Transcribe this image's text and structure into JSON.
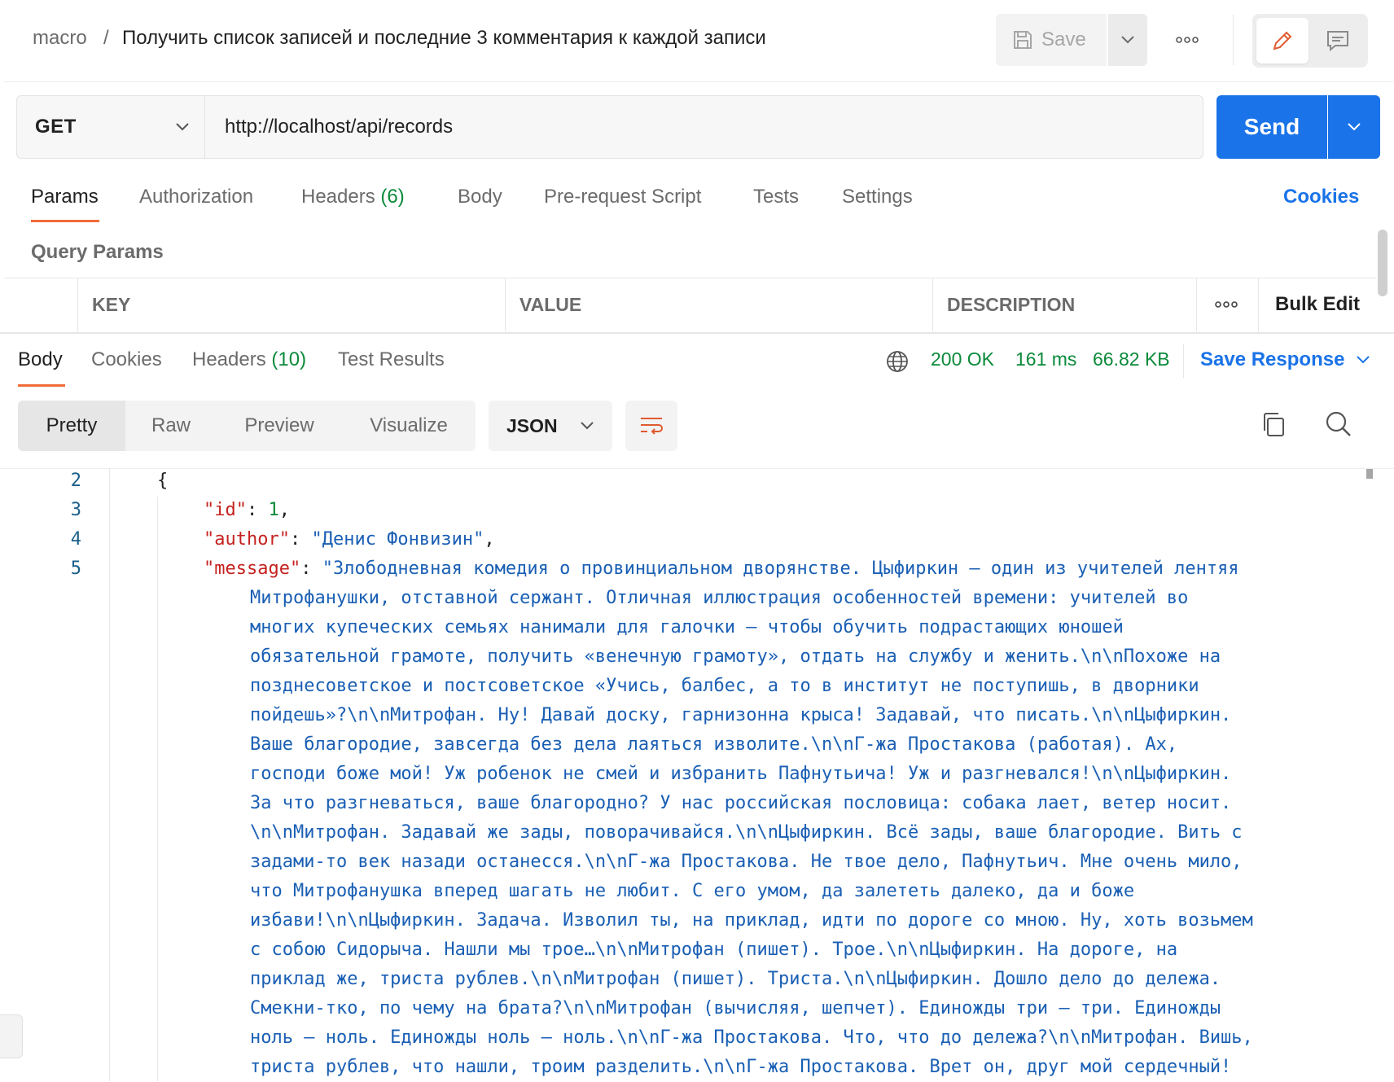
{
  "header": {
    "workspace": "macro",
    "separator": "/",
    "request_name": "Получить список записей и последние 3 комментария к каждой записи",
    "save_label": "Save"
  },
  "request": {
    "method": "GET",
    "url": "http://localhost/api/records",
    "send_label": "Send"
  },
  "request_tabs": {
    "params": "Params",
    "authorization": "Authorization",
    "headers": "Headers",
    "headers_count": "(6)",
    "body": "Body",
    "prerequest": "Pre-request Script",
    "tests": "Tests",
    "settings": "Settings",
    "cookies": "Cookies"
  },
  "query_params": {
    "title": "Query Params",
    "columns": [
      "KEY",
      "VALUE",
      "DESCRIPTION"
    ],
    "bulk_edit": "Bulk Edit"
  },
  "response_tabs": {
    "body": "Body",
    "cookies": "Cookies",
    "headers": "Headers",
    "headers_count": "(10)",
    "test_results": "Test Results"
  },
  "response_status": {
    "status": "200 OK",
    "time": "161 ms",
    "size": "66.82 KB",
    "save_response": "Save Response"
  },
  "format": {
    "pretty": "Pretty",
    "raw": "Raw",
    "preview": "Preview",
    "visualize": "Visualize",
    "language": "JSON"
  },
  "code": {
    "line_numbers": [
      "2",
      "3",
      "4",
      "5"
    ],
    "open_brace": "{",
    "id_key": "\"id\"",
    "id_value": "1",
    "author_key": "\"author\"",
    "author_value": "\"Денис Фонвизин\"",
    "message_key": "\"message\"",
    "message_lines": [
      "\"Злободневная комедия о провинциальном дворянстве. Цыфиркин — один из учителей лентяя",
      "Митрофанушки, отставной сержант. Отличная иллюстрация особенностей времени: учителей во",
      "многих купеческих семьях нанимали для галочки — чтобы обучить подрастающих юношей",
      "обязательной грамоте, получить «венечную грамоту», отдать на службу и женить.\\n\\nПохоже на",
      "позднесоветское и постсоветское «Учись, балбес, а то в институт не поступишь, в дворники",
      "пойдешь»?\\n\\nМитрофан. Ну! Давай доску, гарнизонна крыса! Задавай, что писать.\\n\\nЦыфиркин.",
      "Ваше благородие, завсегда без дела лаяться изволите.\\n\\nГ-жа Простакова (работая). Ах,",
      "господи боже мой! Уж робенок не смей и избранить Пафнутьича! Уж и разгневался!\\n\\nЦыфиркин.",
      "За что разгневаться, ваше благородно? У нас российская пословица: собака лает, ветер носит.",
      "\\n\\nМитрофан. Задавай же зады, поворачивайся.\\n\\nЦыфиркин. Всё зады, ваше благородие. Вить с",
      "задами-то век назади останесся.\\n\\nГ-жа Простакова. Не твое дело, Пафнутьич. Мне очень мило,",
      "что Митрофанушка вперед шагать не любит. С его умом, да залететь далеко, да и боже",
      "избави!\\n\\nЦыфиркин. Задача. Изволил ты, на приклад, идти по дороге со мною. Ну, хоть возьмем",
      "с собою Сидорыча. Нашли мы трое…\\n\\nМитрофан (пишет). Трое.\\n\\nЦыфиркин. На дороге, на",
      "приклад же, триста рублев.\\n\\nМитрофан (пишет). Триста.\\n\\nЦыфиркин. Дошло дело до дележа.",
      "Смекни-тко, по чему на брата?\\n\\nМитрофан (вычисляя, шепчет). Единожды три — три. Единожды",
      "ноль — ноль. Единожды ноль — ноль.\\n\\nГ-жа Простакова. Что, что до дележа?\\n\\nМитрофан. Вишь,",
      "триста рублев, что нашли, троим разделить.\\n\\nГ-жа Простакова. Врет он, друг мой сердечный!"
    ]
  },
  "colors": {
    "accent_blue": "#1a73e8",
    "tab_underline": "#f26b3a",
    "status_green": "#0b8a3a",
    "json_key": "#c5221f",
    "json_string": "#1a5fb4"
  }
}
